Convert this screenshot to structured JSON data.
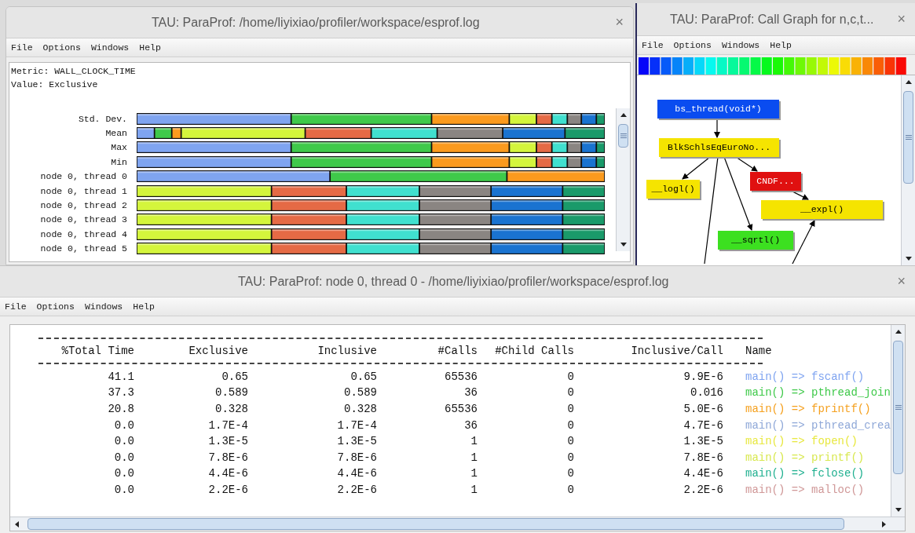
{
  "profile_window": {
    "title": "TAU: ParaProf: /home/liyixiao/profiler/workspace/esprof.log",
    "close": "×",
    "menu": [
      "File",
      "Options",
      "Windows",
      "Help"
    ],
    "metric": "Metric: WALL_CLOCK_TIME",
    "value": "Value: Exclusive",
    "rows": [
      {
        "label": "Std. Dev."
      },
      {
        "label": "Mean"
      },
      {
        "label": "Max"
      },
      {
        "label": "Min"
      },
      {
        "label": "node 0, thread 0"
      },
      {
        "label": "node 0, thread 1"
      },
      {
        "label": "node 0, thread 2"
      },
      {
        "label": "node 0, thread 3"
      },
      {
        "label": "node 0, thread 4"
      },
      {
        "label": "node 0, thread 5"
      }
    ]
  },
  "call_graph_window": {
    "title": "TAU: ParaProf: Call Graph for n,c,t...",
    "close": "×",
    "menu": [
      "File",
      "Options",
      "Windows",
      "Help"
    ],
    "nodes": [
      {
        "label": "bs_thread(void*)",
        "color": "#0a4cf0"
      },
      {
        "label": "BlkSchlsEqEuroNo...",
        "color": "#f5e400"
      },
      {
        "label": "__logl()",
        "color": "#f5e400"
      },
      {
        "label": "CNDF...",
        "color": "#e01010"
      },
      {
        "label": "__expl()",
        "color": "#f5e400"
      },
      {
        "label": "__sqrtl()",
        "color": "#3ce020"
      }
    ]
  },
  "thread_window": {
    "title": "TAU: ParaProf: node 0, thread 0 - /home/liyixiao/profiler/workspace/esprof.log",
    "close": "×",
    "menu": [
      "File",
      "Options",
      "Windows",
      "Help"
    ],
    "columns": [
      "%Total Time",
      "Exclusive",
      "Inclusive",
      "#Calls",
      "#Child Calls",
      "Inclusive/Call",
      "Name"
    ],
    "rows": [
      {
        "cells": [
          "41.1",
          "0.65",
          "0.65",
          "65536",
          "0",
          "9.9E-6"
        ],
        "name": "main() => fscanf()",
        "color": "#7fa4f0"
      },
      {
        "cells": [
          "37.3",
          "0.589",
          "0.589",
          "36",
          "0",
          "0.016"
        ],
        "name": "main() => pthread_join",
        "color": "#3fc94a"
      },
      {
        "cells": [
          "20.8",
          "0.328",
          "0.328",
          "65536",
          "0",
          "5.0E-6"
        ],
        "name": "main() => fprintf()",
        "color": "#f5a01e"
      },
      {
        "cells": [
          "0.0",
          "1.7E-4",
          "1.7E-4",
          "36",
          "0",
          "4.7E-6"
        ],
        "name": "main() => pthread_crea",
        "color": "#8fa8d8"
      },
      {
        "cells": [
          "0.0",
          "1.3E-5",
          "1.3E-5",
          "1",
          "0",
          "1.3E-5"
        ],
        "name": "main() => fopen()",
        "color": "#e8e840"
      },
      {
        "cells": [
          "0.0",
          "7.8E-6",
          "7.8E-6",
          "1",
          "0",
          "7.8E-6"
        ],
        "name": "main() => printf()",
        "color": "#d8e850"
      },
      {
        "cells": [
          "0.0",
          "4.4E-6",
          "4.4E-6",
          "1",
          "0",
          "4.4E-6"
        ],
        "name": "main() => fclose()",
        "color": "#20b090"
      },
      {
        "cells": [
          "0.0",
          "2.2E-6",
          "2.2E-6",
          "1",
          "0",
          "2.2E-6"
        ],
        "name": "main() => malloc()",
        "color": "#d09898"
      }
    ]
  }
}
